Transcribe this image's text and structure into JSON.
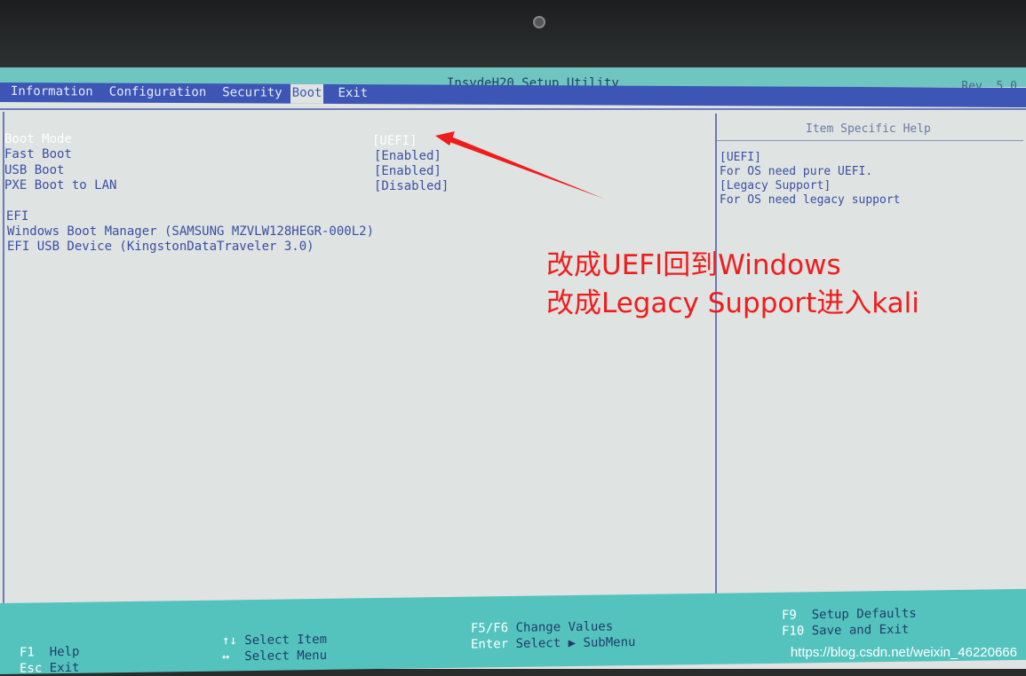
{
  "window": {
    "title": "InsydeH20 Setup Utility",
    "revision": "Rev. 5.0"
  },
  "menu": [
    {
      "label": "Information"
    },
    {
      "label": "Configuration"
    },
    {
      "label": "Security"
    },
    {
      "label": "Boot",
      "active": true
    },
    {
      "label": "Exit"
    }
  ],
  "settings": [
    {
      "label": "Boot Mode",
      "value": "[UEFI]",
      "selected": true
    },
    {
      "label": "Fast Boot",
      "value": "[Enabled]"
    },
    {
      "label": "USB Boot",
      "value": "[Enabled]"
    },
    {
      "label": "PXE Boot to LAN",
      "value": "[Disabled]"
    }
  ],
  "efi": {
    "heading": "EFI",
    "devices": [
      "Windows Boot Manager (SAMSUNG MZVLW128HEGR-000L2)",
      "EFI USB Device (KingstonDataTraveler 3.0)"
    ]
  },
  "help": {
    "title": "Item Specific Help",
    "lines": [
      "[UEFI]",
      "For OS need pure UEFI.",
      "[Legacy Support]",
      "For OS need legacy support"
    ]
  },
  "footer": {
    "f1": {
      "key": "F1",
      "label": "Help"
    },
    "esc": {
      "key": "Esc",
      "label": "Exit"
    },
    "updown": {
      "key": "↑↓",
      "label": "Select Item"
    },
    "leftright": {
      "key": "↔",
      "label": "Select Menu"
    },
    "f5f6": {
      "key": "F5/F6",
      "label": "Change Values"
    },
    "enter": {
      "key": "Enter",
      "label": "Select ▶ SubMenu"
    },
    "f9": {
      "key": "F9",
      "label": "Setup Defaults"
    },
    "f10": {
      "key": "F10",
      "label": "Save and Exit"
    }
  },
  "annotation": {
    "line1": "改成UEFI回到Windows",
    "line2": "改成Legacy Support进入kali",
    "color": "#f01c1c"
  },
  "watermark": "https://blog.csdn.net/weixin_46220666"
}
